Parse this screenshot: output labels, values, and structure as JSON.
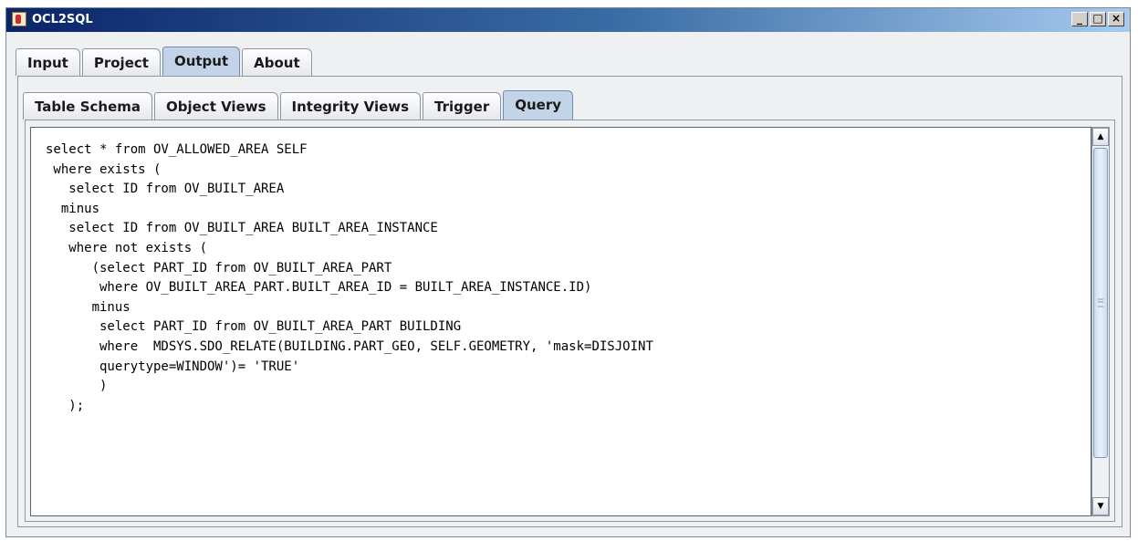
{
  "window": {
    "title": "OCL2SQL",
    "minimize_label": "_",
    "maximize_label": "□",
    "close_label": "×"
  },
  "outer_tabs": [
    "Input",
    "Project",
    "Output",
    "About"
  ],
  "outer_active": "Output",
  "inner_tabs": [
    "Table Schema",
    "Object Views",
    "Integrity Views",
    "Trigger",
    "Query"
  ],
  "inner_active": "Query",
  "query_text": "select * from OV_ALLOWED_AREA SELF\n where exists (\n   select ID from OV_BUILT_AREA\n  minus\n   select ID from OV_BUILT_AREA BUILT_AREA_INSTANCE\n   where not exists (\n      (select PART_ID from OV_BUILT_AREA_PART\n       where OV_BUILT_AREA_PART.BUILT_AREA_ID = BUILT_AREA_INSTANCE.ID)\n      minus\n       select PART_ID from OV_BUILT_AREA_PART BUILDING\n       where  MDSYS.SDO_RELATE(BUILDING.PART_GEO, SELF.GEOMETRY, 'mask=DISJOINT\n       querytype=WINDOW')= 'TRUE'\n       )\n   );",
  "scrollbar": {
    "up_icon": "▲",
    "down_icon": "▼"
  }
}
